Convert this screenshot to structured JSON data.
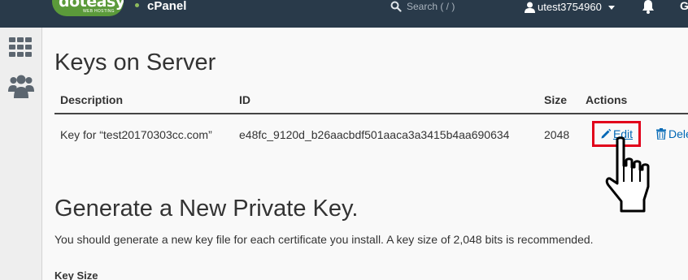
{
  "header": {
    "logo_text": "doteasy",
    "logo_subtext": "WEB HOSTING",
    "product": "cPanel",
    "search": {
      "placeholder": "Search ( / )"
    },
    "user": {
      "name": "utest3754960"
    },
    "logout_glyph": "G"
  },
  "sidebar": {
    "items": [
      {
        "icon": "grid-icon"
      },
      {
        "icon": "users-icon"
      }
    ]
  },
  "main": {
    "title": "Keys on Server",
    "table": {
      "headers": [
        "Description",
        "ID",
        "Size",
        "Actions"
      ],
      "rows": [
        {
          "description": "Key for “test20170303cc.com”",
          "id": "e48fc_9120d_b26aacbdf501aaca3a3415b4aa690634",
          "size": "2048",
          "edit_label": "Edit",
          "delete_label": "Dele"
        }
      ]
    },
    "generate": {
      "title": "Generate a New Private Key.",
      "description": "You should generate a new key file for each certificate you install. A key size of 2,048 bits is recommended.",
      "key_size_label": "Key Size"
    }
  },
  "colors": {
    "topbar": "#293a4a",
    "logo_green": "#5b9a3a",
    "link_blue": "#0067b5",
    "highlight_red": "#e1001a"
  }
}
